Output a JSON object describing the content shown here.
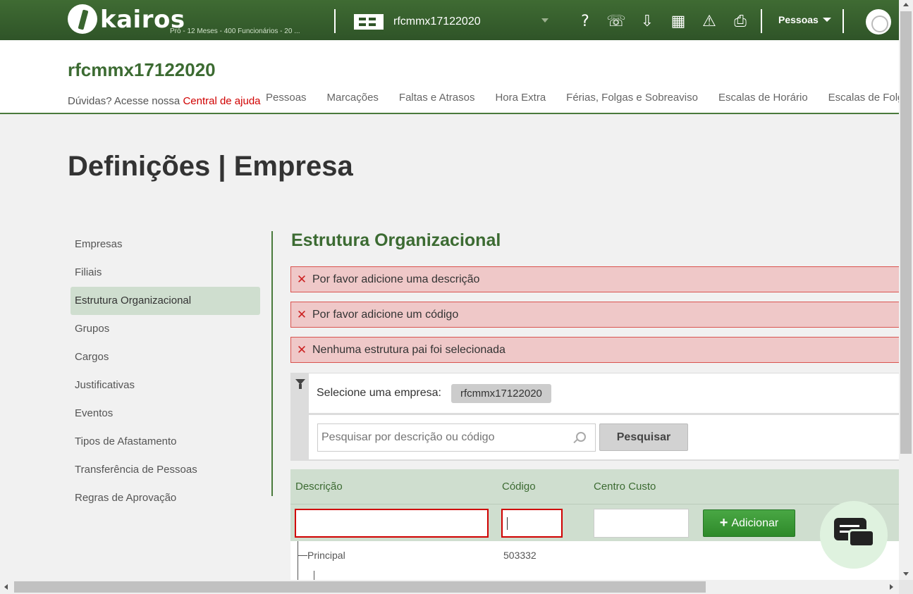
{
  "topbar": {
    "logo_text": "kairos",
    "plan_text": "Pró - 12 Meses - 400 Funcionários - 20 ...",
    "company_select_value": "rfcmmx17122020",
    "people_menu_label": "Pessoas",
    "icons": [
      "help-icon",
      "support-icon",
      "cloud-download-icon",
      "calculator-icon",
      "warning-icon",
      "inbox-icon"
    ],
    "icon_glyphs": [
      "?",
      "☏",
      "⇩",
      "▦",
      "⚠",
      "⎙"
    ]
  },
  "header": {
    "company_title": "rfcmmx17122020",
    "help_prefix": "Dúvidas? Acesse nossa",
    "help_link": "Central de ajuda",
    "nav": [
      "Pessoas",
      "Marcações",
      "Faltas e Atrasos",
      "Hora Extra",
      "Férias, Folgas e Sobreaviso",
      "Escalas de Horário",
      "Escalas de Folgas"
    ]
  },
  "page_title": "Definições | Empresa",
  "sidebar": {
    "items": [
      "Empresas",
      "Filiais",
      "Estrutura Organizacional",
      "Grupos",
      "Cargos",
      "Justificativas",
      "Eventos",
      "Tipos de Afastamento",
      "Transferência de Pessoas",
      "Regras de Aprovação"
    ],
    "active": "Estrutura Organizacional"
  },
  "main": {
    "section_title": "Estrutura Organizacional",
    "alerts": [
      "Por favor adicione uma descrição",
      "Por favor adicione um código",
      "Nenhuma estrutura pai foi selecionada"
    ],
    "filter": {
      "company_label": "Selecione uma empresa:",
      "company_chip": "rfcmmx17122020",
      "search_placeholder": "Pesquisar por descrição ou código",
      "search_button": "Pesquisar"
    },
    "table": {
      "headers": [
        "Descrição",
        "Código",
        "Centro Custo"
      ],
      "add_button": "Adicionar",
      "rows": [
        {
          "descricao": "Principal",
          "codigo": "503332"
        }
      ]
    }
  },
  "colors": {
    "brand_green": "#3c6b32",
    "error_red": "#d00000",
    "alert_bg": "#efc8c8",
    "add_green": "#3a9a36"
  }
}
